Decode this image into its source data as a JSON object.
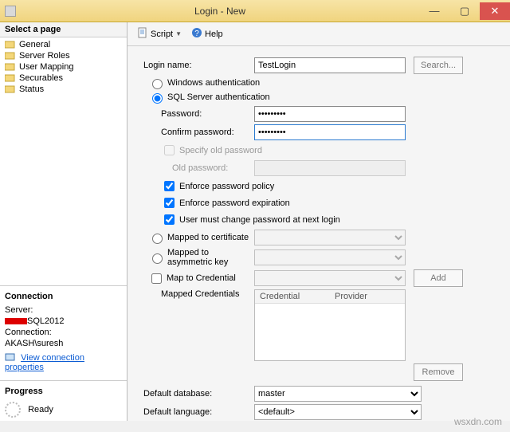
{
  "window": {
    "title": "Login - New"
  },
  "toolbar": {
    "script": "Script",
    "help": "Help"
  },
  "sidebar": {
    "header": "Select a page",
    "items": [
      {
        "label": "General"
      },
      {
        "label": "Server Roles"
      },
      {
        "label": "User Mapping"
      },
      {
        "label": "Securables"
      },
      {
        "label": "Status"
      }
    ]
  },
  "connection": {
    "header": "Connection",
    "server_label": "Server:",
    "server_value": "SQL2012",
    "conn_label": "Connection:",
    "conn_value": "AKASH\\suresh",
    "view_props": "View connection properties"
  },
  "progress": {
    "header": "Progress",
    "status": "Ready"
  },
  "form": {
    "login_name_label": "Login name:",
    "login_name_value": "TestLogin",
    "search_btn": "Search...",
    "auth_windows": "Windows authentication",
    "auth_sql": "SQL Server authentication",
    "password_label": "Password:",
    "password_value": "•••••••••",
    "confirm_label": "Confirm password:",
    "confirm_value": "•••••••••",
    "specify_old": "Specify old password",
    "old_pwd_label": "Old password:",
    "enforce_policy": "Enforce password policy",
    "enforce_expire": "Enforce password expiration",
    "must_change": "User must change password at next login",
    "mapped_cert": "Mapped to certificate",
    "mapped_asym": "Mapped to asymmetric key",
    "map_cred": "Map to Credential",
    "add_btn": "Add",
    "mapped_creds_label": "Mapped Credentials",
    "cred_col1": "Credential",
    "cred_col2": "Provider",
    "remove_btn": "Remove",
    "def_db_label": "Default database:",
    "def_db_value": "master",
    "def_lang_label": "Default language:",
    "def_lang_value": "<default>"
  },
  "watermark": "wsxdn.com"
}
